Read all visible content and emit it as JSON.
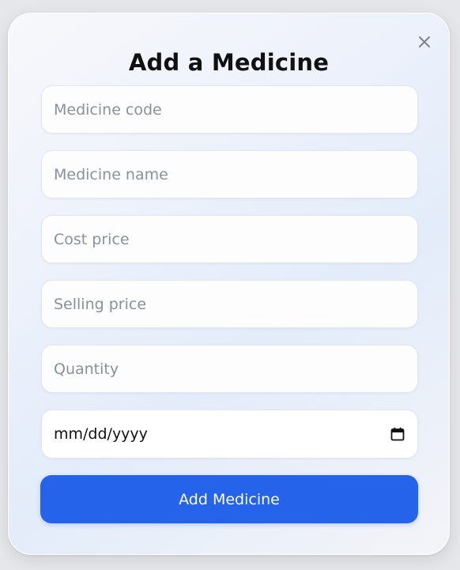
{
  "modal": {
    "title": "Add a Medicine",
    "close_icon": "close-icon"
  },
  "fields": {
    "medicine_code": {
      "placeholder": "Medicine code",
      "value": ""
    },
    "medicine_name": {
      "placeholder": "Medicine name",
      "value": ""
    },
    "cost_price": {
      "placeholder": "Cost price",
      "value": ""
    },
    "selling_price": {
      "placeholder": "Selling price",
      "value": ""
    },
    "quantity": {
      "placeholder": "Quantity",
      "value": ""
    },
    "date": {
      "display": "mm/dd/yyyy",
      "icon": "calendar-icon"
    }
  },
  "submit_label": "Add Medicine",
  "colors": {
    "accent": "#2563eb",
    "placeholder": "#8a9199"
  }
}
